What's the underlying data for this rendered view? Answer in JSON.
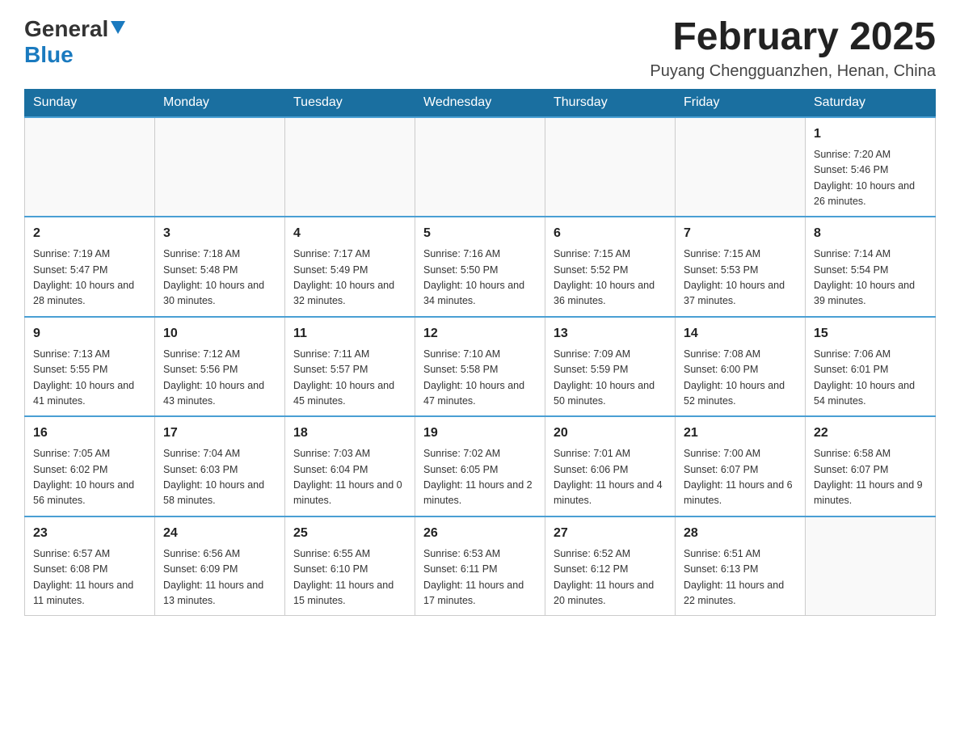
{
  "header": {
    "logo": {
      "general_text": "General",
      "blue_text": "Blue"
    },
    "title": "February 2025",
    "subtitle": "Puyang Chengguanzhen, Henan, China"
  },
  "calendar": {
    "days_of_week": [
      "Sunday",
      "Monday",
      "Tuesday",
      "Wednesday",
      "Thursday",
      "Friday",
      "Saturday"
    ],
    "weeks": [
      {
        "days": [
          {
            "number": "",
            "info": ""
          },
          {
            "number": "",
            "info": ""
          },
          {
            "number": "",
            "info": ""
          },
          {
            "number": "",
            "info": ""
          },
          {
            "number": "",
            "info": ""
          },
          {
            "number": "",
            "info": ""
          },
          {
            "number": "1",
            "info": "Sunrise: 7:20 AM\nSunset: 5:46 PM\nDaylight: 10 hours and 26 minutes."
          }
        ]
      },
      {
        "days": [
          {
            "number": "2",
            "info": "Sunrise: 7:19 AM\nSunset: 5:47 PM\nDaylight: 10 hours and 28 minutes."
          },
          {
            "number": "3",
            "info": "Sunrise: 7:18 AM\nSunset: 5:48 PM\nDaylight: 10 hours and 30 minutes."
          },
          {
            "number": "4",
            "info": "Sunrise: 7:17 AM\nSunset: 5:49 PM\nDaylight: 10 hours and 32 minutes."
          },
          {
            "number": "5",
            "info": "Sunrise: 7:16 AM\nSunset: 5:50 PM\nDaylight: 10 hours and 34 minutes."
          },
          {
            "number": "6",
            "info": "Sunrise: 7:15 AM\nSunset: 5:52 PM\nDaylight: 10 hours and 36 minutes."
          },
          {
            "number": "7",
            "info": "Sunrise: 7:15 AM\nSunset: 5:53 PM\nDaylight: 10 hours and 37 minutes."
          },
          {
            "number": "8",
            "info": "Sunrise: 7:14 AM\nSunset: 5:54 PM\nDaylight: 10 hours and 39 minutes."
          }
        ]
      },
      {
        "days": [
          {
            "number": "9",
            "info": "Sunrise: 7:13 AM\nSunset: 5:55 PM\nDaylight: 10 hours and 41 minutes."
          },
          {
            "number": "10",
            "info": "Sunrise: 7:12 AM\nSunset: 5:56 PM\nDaylight: 10 hours and 43 minutes."
          },
          {
            "number": "11",
            "info": "Sunrise: 7:11 AM\nSunset: 5:57 PM\nDaylight: 10 hours and 45 minutes."
          },
          {
            "number": "12",
            "info": "Sunrise: 7:10 AM\nSunset: 5:58 PM\nDaylight: 10 hours and 47 minutes."
          },
          {
            "number": "13",
            "info": "Sunrise: 7:09 AM\nSunset: 5:59 PM\nDaylight: 10 hours and 50 minutes."
          },
          {
            "number": "14",
            "info": "Sunrise: 7:08 AM\nSunset: 6:00 PM\nDaylight: 10 hours and 52 minutes."
          },
          {
            "number": "15",
            "info": "Sunrise: 7:06 AM\nSunset: 6:01 PM\nDaylight: 10 hours and 54 minutes."
          }
        ]
      },
      {
        "days": [
          {
            "number": "16",
            "info": "Sunrise: 7:05 AM\nSunset: 6:02 PM\nDaylight: 10 hours and 56 minutes."
          },
          {
            "number": "17",
            "info": "Sunrise: 7:04 AM\nSunset: 6:03 PM\nDaylight: 10 hours and 58 minutes."
          },
          {
            "number": "18",
            "info": "Sunrise: 7:03 AM\nSunset: 6:04 PM\nDaylight: 11 hours and 0 minutes."
          },
          {
            "number": "19",
            "info": "Sunrise: 7:02 AM\nSunset: 6:05 PM\nDaylight: 11 hours and 2 minutes."
          },
          {
            "number": "20",
            "info": "Sunrise: 7:01 AM\nSunset: 6:06 PM\nDaylight: 11 hours and 4 minutes."
          },
          {
            "number": "21",
            "info": "Sunrise: 7:00 AM\nSunset: 6:07 PM\nDaylight: 11 hours and 6 minutes."
          },
          {
            "number": "22",
            "info": "Sunrise: 6:58 AM\nSunset: 6:07 PM\nDaylight: 11 hours and 9 minutes."
          }
        ]
      },
      {
        "days": [
          {
            "number": "23",
            "info": "Sunrise: 6:57 AM\nSunset: 6:08 PM\nDaylight: 11 hours and 11 minutes."
          },
          {
            "number": "24",
            "info": "Sunrise: 6:56 AM\nSunset: 6:09 PM\nDaylight: 11 hours and 13 minutes."
          },
          {
            "number": "25",
            "info": "Sunrise: 6:55 AM\nSunset: 6:10 PM\nDaylight: 11 hours and 15 minutes."
          },
          {
            "number": "26",
            "info": "Sunrise: 6:53 AM\nSunset: 6:11 PM\nDaylight: 11 hours and 17 minutes."
          },
          {
            "number": "27",
            "info": "Sunrise: 6:52 AM\nSunset: 6:12 PM\nDaylight: 11 hours and 20 minutes."
          },
          {
            "number": "28",
            "info": "Sunrise: 6:51 AM\nSunset: 6:13 PM\nDaylight: 11 hours and 22 minutes."
          },
          {
            "number": "",
            "info": ""
          }
        ]
      }
    ]
  }
}
